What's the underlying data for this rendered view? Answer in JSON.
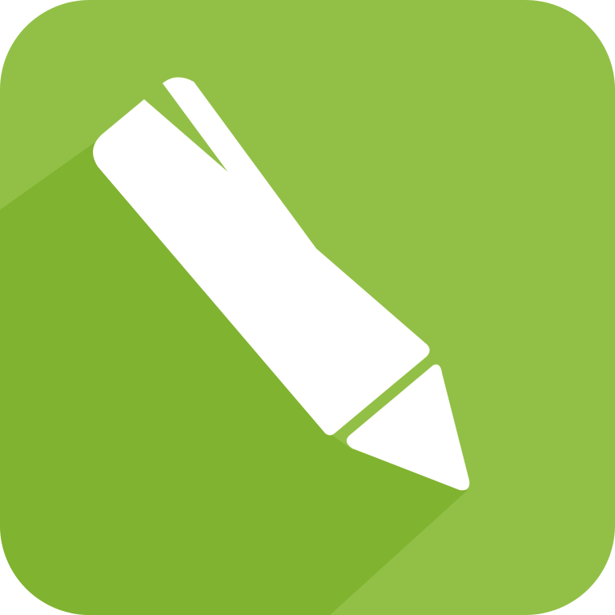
{
  "icon": {
    "name": "pencil-icon",
    "colors": {
      "background": "#92c047",
      "shadow": "#80b32f",
      "pencil": "#ffffff"
    }
  }
}
